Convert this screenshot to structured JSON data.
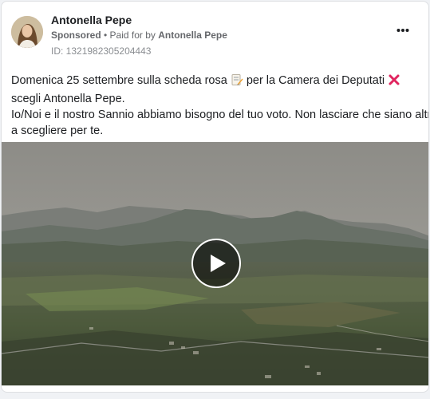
{
  "post": {
    "author_name": "Antonella Pepe",
    "sponsored_label": "Sponsored",
    "separator": " • ",
    "paid_for_prefix": "Paid for by ",
    "paid_for_name": "Antonella Pepe",
    "ad_id": "ID: 1321982305204443",
    "text_line1_a": "Domenica 25 settembre sulla scheda rosa",
    "text_line1_b": "per la Camera dei Deputati",
    "text_line2": "scegli Antonella Pepe.",
    "text_line3": "Io/Noi e il nostro Sannio abbiamo bisogno del tuo voto. Non lasciare che siano altri",
    "text_line4": "a scegliere per te."
  },
  "media": {
    "type": "video",
    "play_icon": "play-icon"
  },
  "icons": {
    "more": "more-options-icon",
    "ballot": "memo-emoji-icon",
    "cross": "cross-mark-emoji-icon"
  },
  "colors": {
    "accent_cross": "#e0245e",
    "muted_text": "#65676b"
  }
}
